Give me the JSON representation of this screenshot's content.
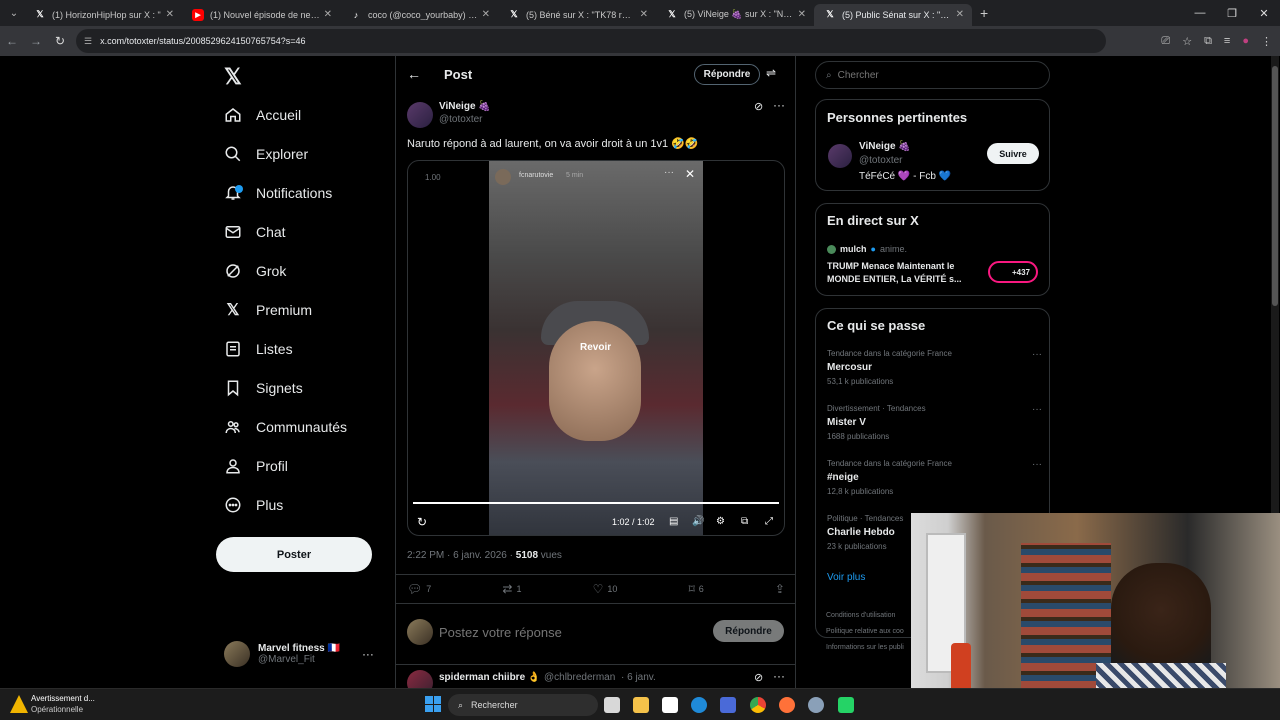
{
  "browser": {
    "tabs": [
      {
        "title": "(1) HorizonHipHop sur X : \"",
        "icon": "x-icon"
      },
      {
        "title": "(1) Nouvel épisode de neige : le",
        "icon": "youtube-icon"
      },
      {
        "title": "coco (@coco_yourbaby) | TikTo",
        "icon": "tiktok-icon"
      },
      {
        "title": "(5) Béné sur X : \"TK78 réagit à l",
        "icon": "x-icon"
      },
      {
        "title": "(5) ViNeige 🍇 sur X : \"Naruto",
        "icon": "x-icon"
      },
      {
        "title": "(5) Public Sénat sur X : \"Dépen",
        "icon": "x-icon"
      }
    ],
    "url": "x.com/totoxter/status/2008529624150765754?s=46"
  },
  "sidebar": {
    "items": [
      {
        "label": "Accueil",
        "icon": "home-icon"
      },
      {
        "label": "Explorer",
        "icon": "search-icon"
      },
      {
        "label": "Notifications",
        "icon": "bell-icon"
      },
      {
        "label": "Chat",
        "icon": "mail-icon"
      },
      {
        "label": "Grok",
        "icon": "grok-icon"
      },
      {
        "label": "Premium",
        "icon": "x-icon"
      },
      {
        "label": "Listes",
        "icon": "list-icon"
      },
      {
        "label": "Signets",
        "icon": "bookmark-icon"
      },
      {
        "label": "Communautés",
        "icon": "communities-icon"
      },
      {
        "label": "Profil",
        "icon": "profile-icon"
      },
      {
        "label": "Plus",
        "icon": "more-circle-icon"
      }
    ],
    "post_button": "Poster",
    "account": {
      "name": "Marvel fitness 🇫🇷",
      "handle": "@Marvel_Fit"
    }
  },
  "post": {
    "header_title": "Post",
    "reply_button": "Répondre",
    "author_name": "ViNeige 🍇",
    "author_handle": "@totoxter",
    "text": "Naruto répond à ad laurent, on va avoir droit à un 1v1 🤣🤣",
    "video": {
      "speed": "1.00",
      "story_user": "fcnarutovie",
      "story_time": "5 min",
      "replay_label": "Revoir",
      "time": "1:02 / 1:02",
      "progress": 1.0
    },
    "meta_time": "2:22 PM · 6 janv. 2026 · ",
    "meta_views": "5108",
    "meta_views_label": " vues",
    "stats": {
      "replies": "7",
      "reposts": "1",
      "likes": "10",
      "bookmarks": "6"
    },
    "reply_placeholder": "Postez votre réponse",
    "reply_submit": "Répondre",
    "next_reply": {
      "name": "spiderman chiibre 👌",
      "handle": "@chlbrederman",
      "time": "· 6 janv."
    }
  },
  "right": {
    "search_placeholder": "Chercher",
    "relevant": {
      "title": "Personnes pertinentes",
      "name": "ViNeige 🍇",
      "handle": "@totoxter",
      "bio": "TéFéCé 💜 - Fcb 💙",
      "follow": "Suivre"
    },
    "live": {
      "title": "En direct sur X",
      "host": "mulch",
      "topic": "anime.",
      "headline": "TRUMP Menace Maintenant le MONDE ENTIER, La VÉRITÉ s...",
      "count": "+437"
    },
    "trends": {
      "title": "Ce qui se passe",
      "items": [
        {
          "context": "Tendance dans la catégorie France",
          "name": "Mercosur",
          "count": "53,1 k publications"
        },
        {
          "context": "Divertissement · Tendances",
          "name": "Mister V",
          "count": "1688 publications"
        },
        {
          "context": "Tendance dans la catégorie France",
          "name": "#neige",
          "count": "12,8 k publications"
        },
        {
          "context": "Politique · Tendances",
          "name": "Charlie Hebdo",
          "count": "23 k publications"
        }
      ],
      "more": "Voir plus"
    },
    "footer": [
      "Conditions d'utilisation",
      "Politique relative aux coo",
      "Informations sur les publi"
    ]
  },
  "taskbar": {
    "notification_title": "Avertissement d...",
    "notification_sub": "Opérationnelle",
    "search": "Rechercher"
  }
}
